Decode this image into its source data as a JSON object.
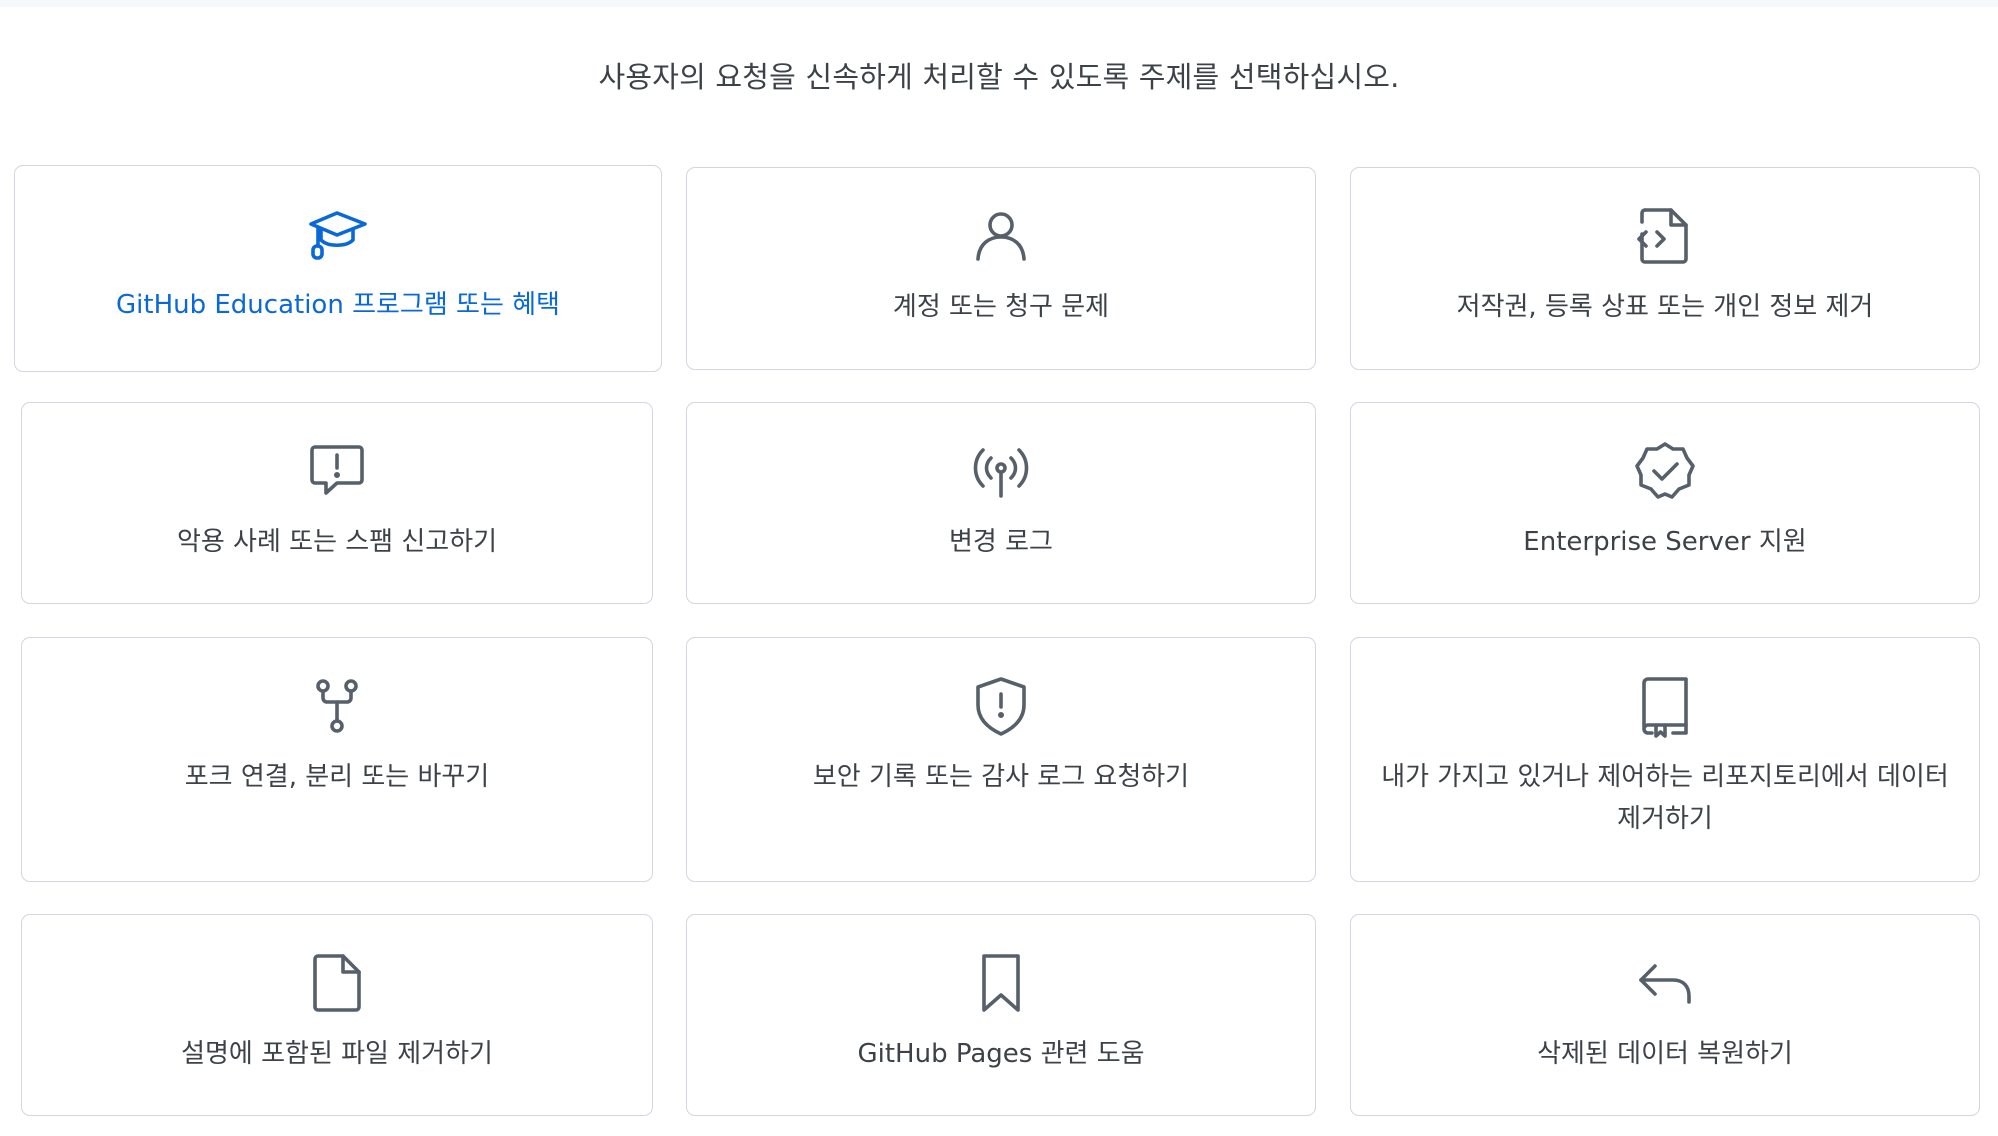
{
  "header": {
    "prompt": "사용자의 요청을 신속하게 처리할 수 있도록 주제를 선택하십시오."
  },
  "colors": {
    "accent": "#0969da",
    "text": "#3d4249",
    "icon": "#57606a",
    "border": "#d0d7de"
  },
  "topics": [
    {
      "label": "GitHub Education 프로그램 또는 혜택",
      "icon": "mortar-board-icon",
      "selected": true
    },
    {
      "label": "계정 또는 청구 문제",
      "icon": "person-icon"
    },
    {
      "label": "저작권, 등록 상표 또는 개인 정보 제거",
      "icon": "file-code-icon"
    },
    {
      "label": "악용 사례 또는 스팸 신고하기",
      "icon": "report-icon"
    },
    {
      "label": "변경 로그",
      "icon": "broadcast-icon"
    },
    {
      "label": "Enterprise Server 지원",
      "icon": "verified-icon"
    },
    {
      "label": "포크 연결, 분리 또는 바꾸기",
      "icon": "repo-forked-icon"
    },
    {
      "label": "보안 기록 또는 감사 로그 요청하기",
      "icon": "shield-alert-icon"
    },
    {
      "label": "내가 가지고 있거나 제어하는 리포지토리에서 데이터 제거하기",
      "icon": "repo-icon"
    },
    {
      "label": "설명에 포함된 파일 제거하기",
      "icon": "file-icon"
    },
    {
      "label": "GitHub Pages 관련 도움",
      "icon": "bookmark-icon"
    },
    {
      "label": "삭제된 데이터 복원하기",
      "icon": "reply-icon"
    }
  ]
}
